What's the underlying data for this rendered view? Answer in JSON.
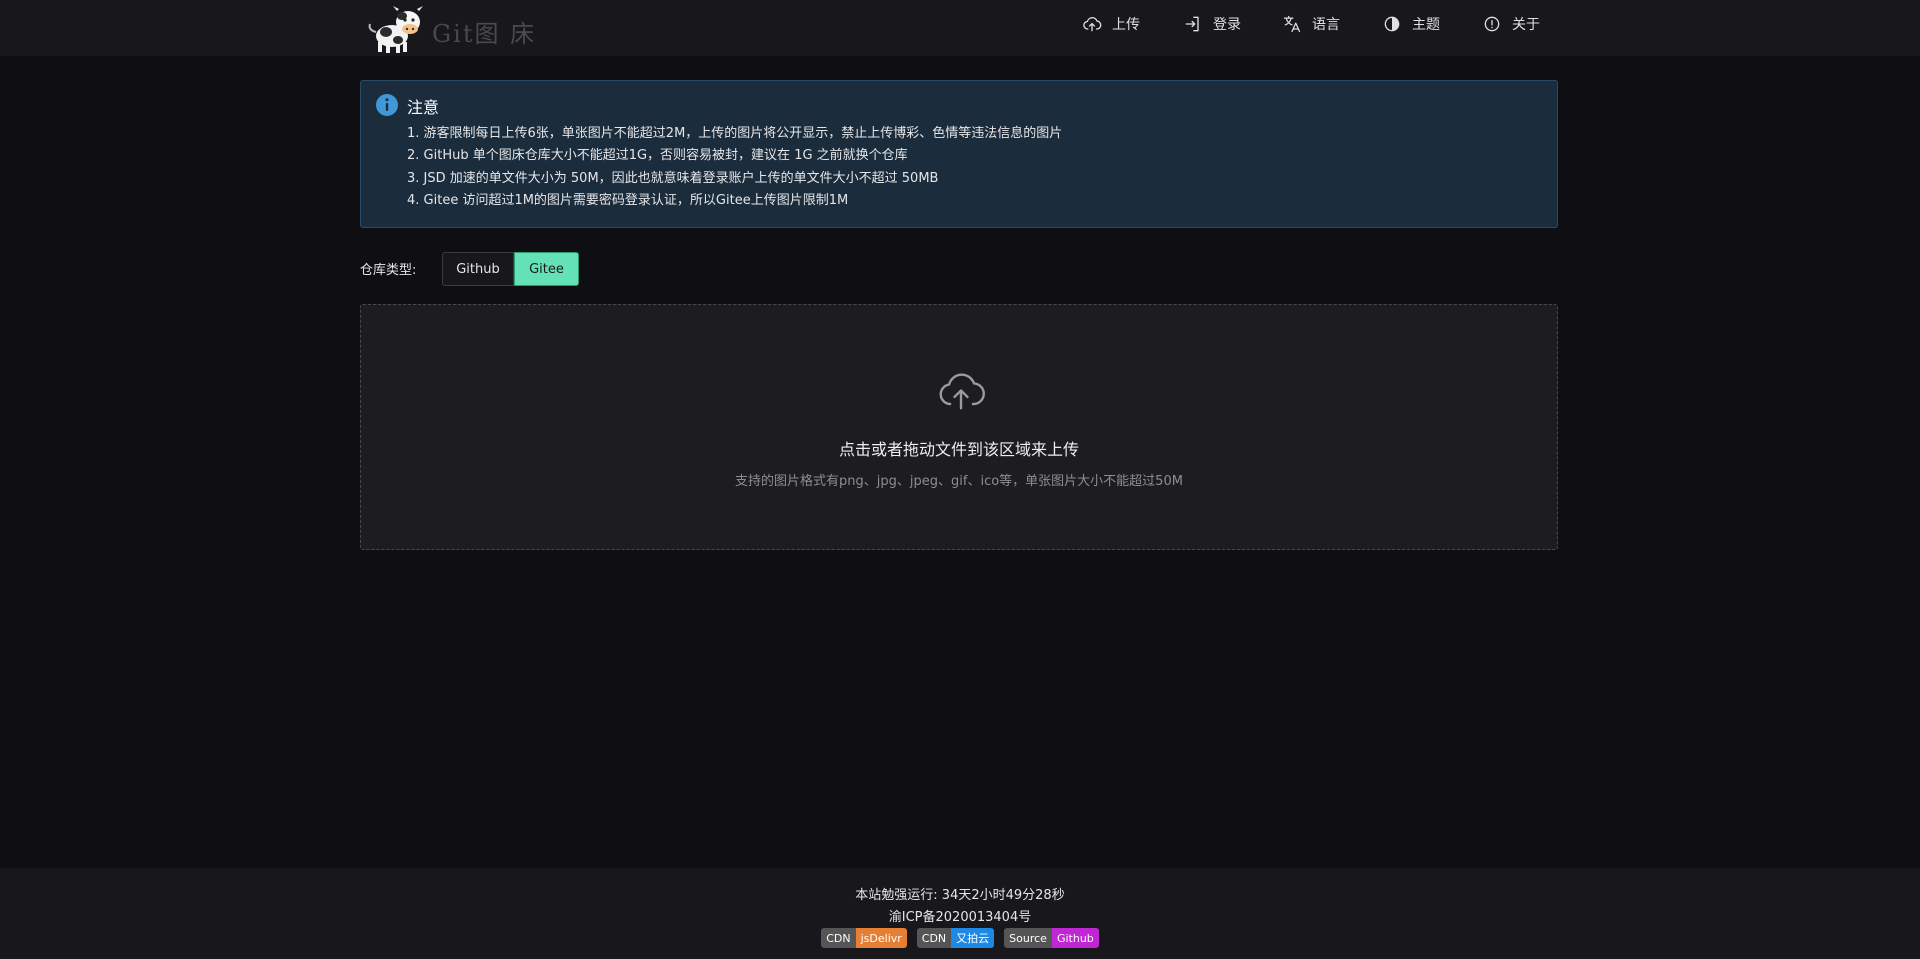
{
  "header": {
    "logo_text": "Git图 床",
    "nav": [
      {
        "label": "上传",
        "icon": "cloud-upload-icon"
      },
      {
        "label": "登录",
        "icon": "login-icon"
      },
      {
        "label": "语言",
        "icon": "translate-icon"
      },
      {
        "label": "主题",
        "icon": "contrast-icon"
      },
      {
        "label": "关于",
        "icon": "info-circle-icon"
      }
    ]
  },
  "notice": {
    "title": "注意",
    "items": [
      "1. 游客限制每日上传6张，单张图片不能超过2M，上传的图片将公开显示，禁止上传博彩、色情等违法信息的图片",
      "2. GitHub 单个图床仓库大小不能超过1G，否则容易被封，建议在 1G 之前就换个仓库",
      "3. JSD 加速的单文件大小为 50M，因此也就意味着登录账户上传的单文件大小不超过 50MB",
      "4. Gitee 访问超过1M的图片需要密码登录认证，所以Gitee上传图片限制1M"
    ]
  },
  "repo": {
    "label": "仓库类型:",
    "options": [
      "Github",
      "Gitee"
    ],
    "selected": "Gitee"
  },
  "upload": {
    "title": "点击或者拖动文件到该区域来上传",
    "hint": "支持的图片格式有png、jpg、jpeg、gif、ico等，单张图片大小不能超过50M"
  },
  "footer": {
    "runtime": "本站勉强运行: 34天2小时49分28秒",
    "icp": "渝ICP备2020013404号",
    "badges": [
      {
        "left": "CDN",
        "right": "jsDelivr",
        "color": "#e67e33"
      },
      {
        "left": "CDN",
        "right": "又拍云",
        "color": "#1e88e5"
      },
      {
        "left": "Source",
        "right": "Github",
        "color": "#c026d3"
      }
    ]
  },
  "colors": {
    "accent": "#63e2b7",
    "notice_bg": "#1b2c3d",
    "info_icon": "#4098d7"
  }
}
